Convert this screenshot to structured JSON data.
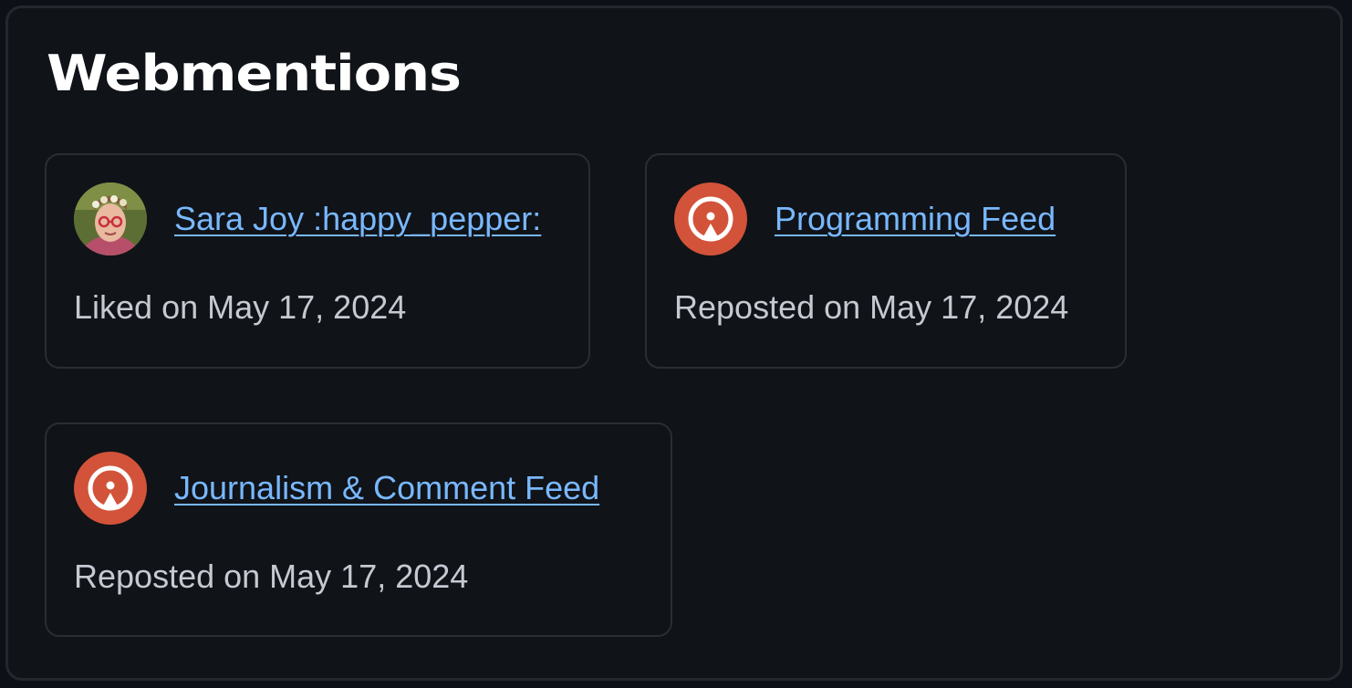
{
  "section": {
    "title": "Webmentions"
  },
  "mentions": [
    {
      "author": "Sara Joy :happy_pepper:",
      "activity": "Liked on May 17, 2024",
      "avatar_icon": "profile-photo-avatar"
    },
    {
      "author": "Programming Feed",
      "activity": "Reposted on May 17, 2024",
      "avatar_icon": "broadcast-feed-icon"
    },
    {
      "author": "Journalism & Comment Feed",
      "activity": "Reposted on May 17, 2024",
      "avatar_icon": "broadcast-feed-icon"
    }
  ],
  "colors": {
    "background": "#101318",
    "card_border": "#2a2d34",
    "link": "#79b8ff",
    "text": "#c5c9d1",
    "feed_avatar": "#d2533a"
  }
}
